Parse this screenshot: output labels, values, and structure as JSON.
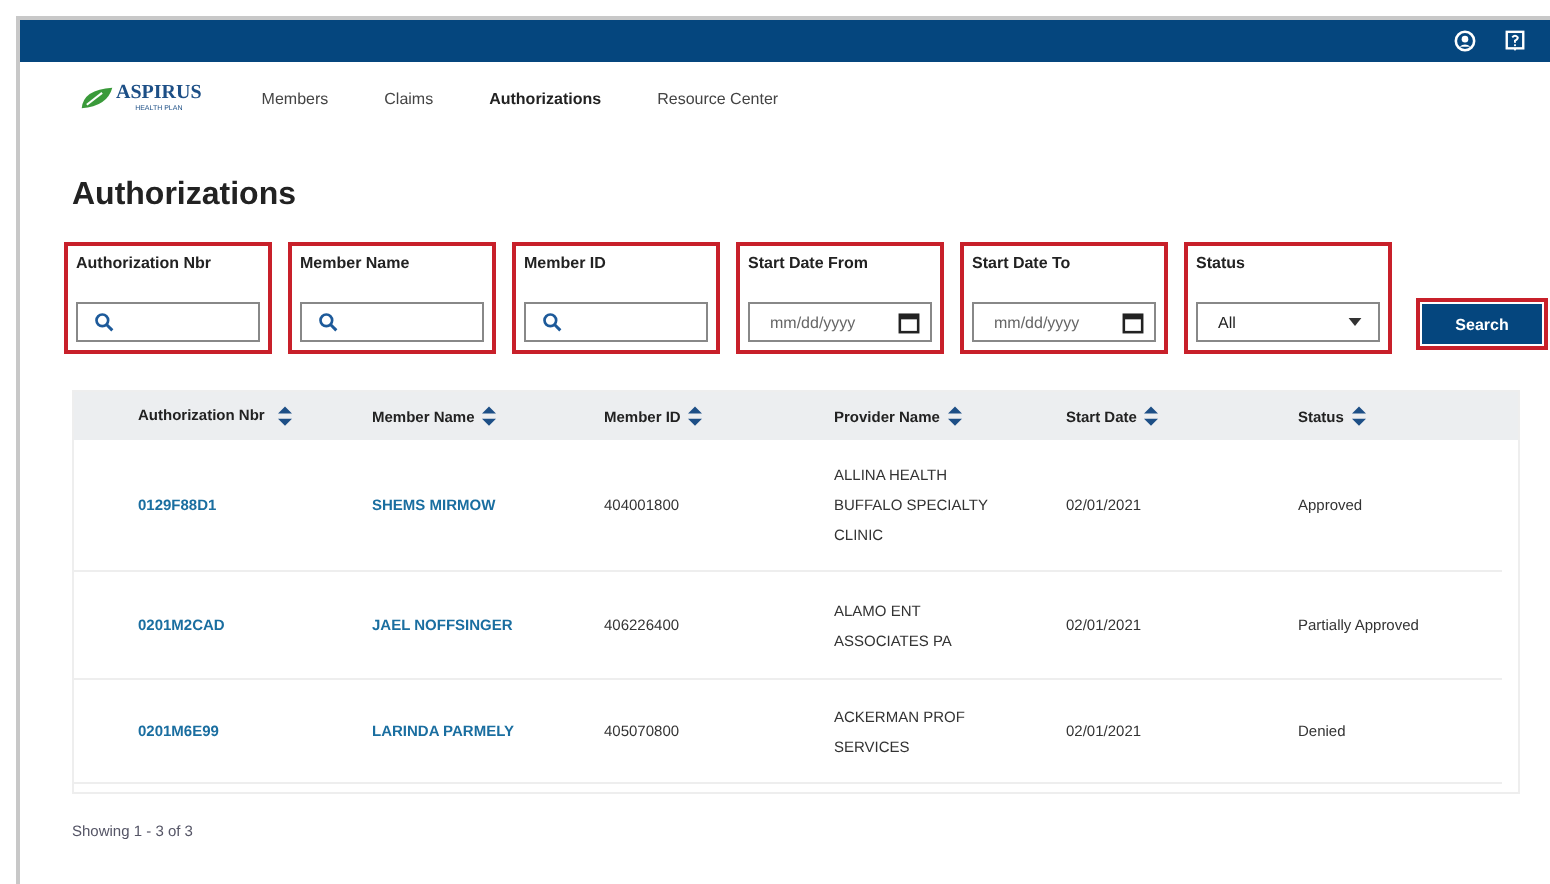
{
  "logo": {
    "name": "ASPIRUS",
    "subtitle": "HEALTH PLAN"
  },
  "nav": [
    {
      "label": "Members",
      "selected": false
    },
    {
      "label": "Claims",
      "selected": false
    },
    {
      "label": "Authorizations",
      "selected": true
    },
    {
      "label": "Resource Center",
      "selected": false
    }
  ],
  "page_title": "Authorizations",
  "filters": [
    {
      "label": "Authorization Nbr",
      "kind": "search",
      "highlighted": true
    },
    {
      "label": "Member Name",
      "kind": "search",
      "highlighted": true
    },
    {
      "label": "Member ID",
      "kind": "search",
      "highlighted": true
    },
    {
      "label": "Start Date From",
      "kind": "date",
      "placeholder": "mm/dd/yyyy",
      "highlighted": true
    },
    {
      "label": "Start Date To",
      "kind": "date",
      "placeholder": "mm/dd/yyyy",
      "highlighted": true
    },
    {
      "label": "Status",
      "kind": "select",
      "value": "All",
      "highlighted": true
    }
  ],
  "search_button": {
    "label": "Search",
    "highlighted": true
  },
  "table": {
    "columns": [
      "Authorization Nbr",
      "Member Name",
      "Member ID",
      "Provider Name",
      "Start Date",
      "Status"
    ],
    "rows": [
      [
        "0129F88D1",
        "SHEMS MIRMOW",
        "404001800",
        "ALLINA HEALTH BUFFALO SPECIALTY CLINIC",
        "02/01/2021",
        "Approved"
      ],
      [
        "0201M2CAD",
        "JAEL NOFFSINGER",
        "406226400",
        "ALAMO ENT ASSOCIATES PA",
        "02/01/2021",
        "Partially Approved"
      ],
      [
        "0201M6E99",
        "LARINDA PARMELY",
        "405070800",
        "ACKERMAN PROF SERVICES",
        "02/01/2021",
        "Denied"
      ]
    ]
  },
  "footer": "Showing 1 - 3 of 3"
}
